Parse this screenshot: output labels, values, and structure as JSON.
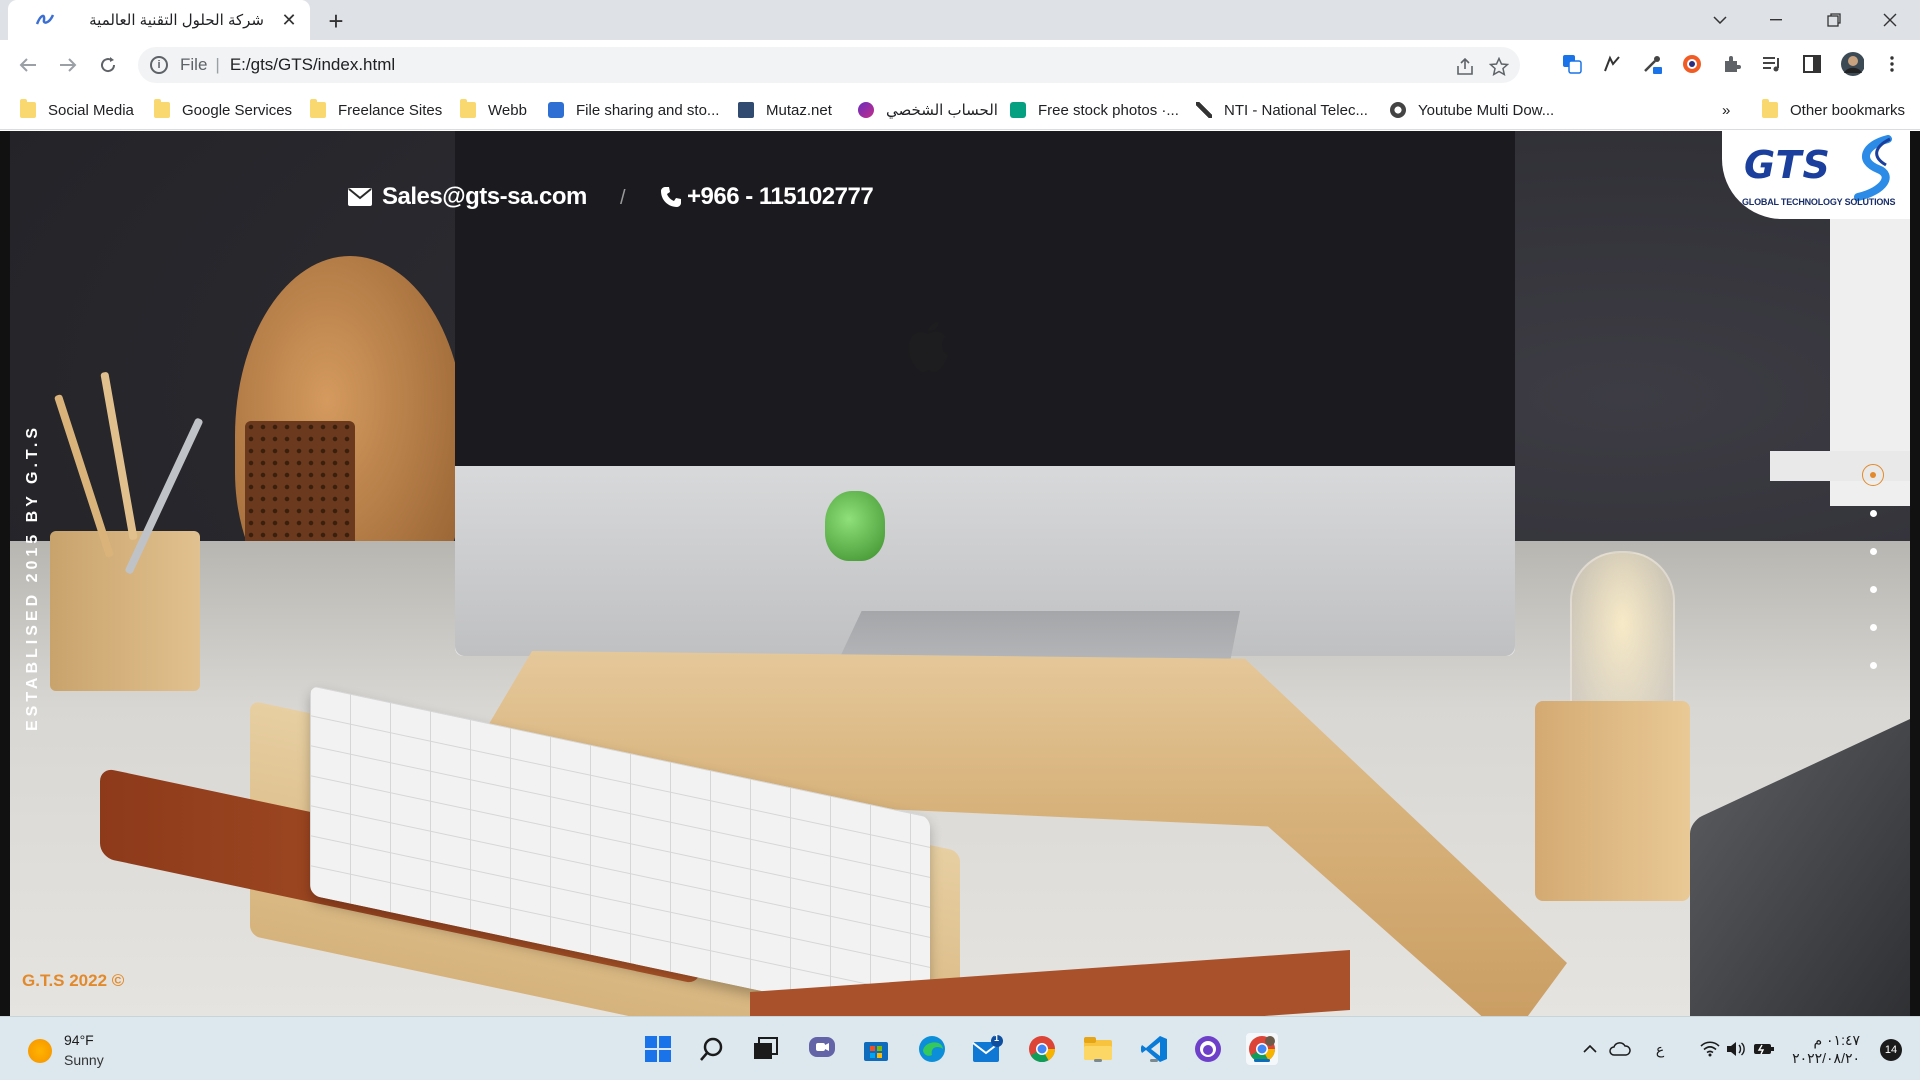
{
  "browser": {
    "tab_title": "شركة الحلول التقنية العالمية",
    "tab_close": "✕",
    "new_tab": "+",
    "url_scheme": "File",
    "url_separator": "|",
    "url": "E:/gts/GTS/index.html"
  },
  "bookmarks": {
    "items": [
      {
        "label": "Social Media",
        "icon": "folder-icon"
      },
      {
        "label": "Google Services",
        "icon": "folder-icon"
      },
      {
        "label": "Freelance Sites",
        "icon": "folder-icon"
      },
      {
        "label": "Webb",
        "icon": "folder-icon"
      },
      {
        "label": "File sharing and sto...",
        "icon": "site-icon"
      },
      {
        "label": "Mutaz.net",
        "icon": "site-icon"
      },
      {
        "label": "الحساب الشخصي",
        "icon": "site-icon"
      },
      {
        "label": "Free stock photos ·...",
        "icon": "site-icon"
      },
      {
        "label": "NTI - National Telec...",
        "icon": "site-icon"
      },
      {
        "label": "Youtube Multi Dow...",
        "icon": "site-icon"
      }
    ],
    "overflow": "»",
    "other": "Other bookmarks"
  },
  "page": {
    "email": "Sales@gts-sa.com",
    "separator": "/",
    "phone": "+966 - 115102777",
    "vertical_text": "ESTABLISED 2015 BY G.T.S",
    "copyright": "G.T.S 2022 ©",
    "logo_text": "GTS",
    "logo_subtitle": "GLOBAL TECHNOLOGY SOLUTIONS",
    "slider_dots": 6,
    "active_dot": 0,
    "accent_color": "#e28a2b"
  },
  "taskbar": {
    "temperature": "94°F",
    "weather": "Sunny",
    "keyboard_lang": "ع",
    "time": "٠١:٤٧ م",
    "date": "٢٠٢٢/٠٨/٢٠",
    "notifications": "14",
    "mail_badge": "1"
  }
}
